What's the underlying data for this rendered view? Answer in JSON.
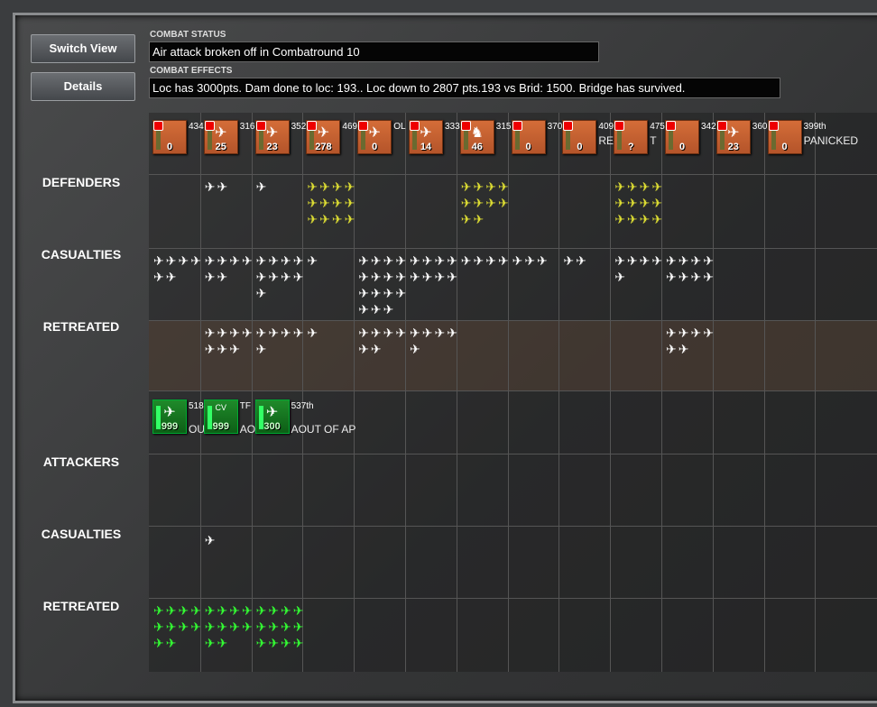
{
  "buttons": {
    "switch_view": "Switch View",
    "details": "Details"
  },
  "combat_status": {
    "label": "COMBAT STATUS",
    "text": "Air attack broken off in Combatround  10"
  },
  "combat_effects": {
    "label": "COMBAT EFFECTS",
    "text": "Loc has  3000pts. Dam done to loc: 193.. Loc down to 2807 pts.193 vs Brid: 1500. Bridge has survived."
  },
  "rows": {
    "defenders": "DEFENDERS",
    "def_casualties": "CASUALTIES",
    "def_retreated": "RETREATED",
    "attackers": "ATTACKERS",
    "att_casualties": "CASUALTIES",
    "att_retreated": "RETREATED"
  },
  "defender_units": [
    {
      "id": "434",
      "value": "0",
      "icon": ""
    },
    {
      "id": "316",
      "value": "25",
      "icon": "plane"
    },
    {
      "id": "352",
      "value": "23",
      "icon": "plane"
    },
    {
      "id": "469",
      "value": "278",
      "icon": "plane"
    },
    {
      "id": "OL",
      "value": "0",
      "icon": "plane"
    },
    {
      "id": "333",
      "value": "14",
      "icon": "plane"
    },
    {
      "id": "315",
      "value": "46",
      "icon": "infantry"
    },
    {
      "id": "370",
      "value": "0",
      "icon": ""
    },
    {
      "id": "409",
      "value": "0",
      "icon": "",
      "status": "RE"
    },
    {
      "id": "475",
      "value": "?",
      "icon": "",
      "status": "T"
    },
    {
      "id": "342",
      "value": "0",
      "icon": ""
    },
    {
      "id": "360",
      "value": "23",
      "icon": "plane"
    },
    {
      "id": "399th",
      "value": "0",
      "icon": "",
      "status": "PANICKED"
    }
  ],
  "attacker_units": [
    {
      "id": "518",
      "value": "999",
      "badge": "",
      "status": "OU"
    },
    {
      "id": "TF",
      "value": "999",
      "badge": "CV",
      "status": "AOU"
    },
    {
      "id": "537th",
      "value": "300",
      "badge": "",
      "status": "AOUT OF AP"
    }
  ],
  "icon_counts": {
    "defenders": [
      0,
      2,
      1,
      12,
      0,
      0,
      10,
      0,
      0,
      12,
      0,
      0,
      0
    ],
    "def_casualties": [
      6,
      6,
      9,
      1,
      15,
      8,
      4,
      3,
      2,
      5,
      8,
      0,
      0
    ],
    "def_retreated": [
      0,
      7,
      5,
      1,
      6,
      5,
      0,
      0,
      0,
      0,
      6,
      0,
      0
    ],
    "att_casualties": [
      0,
      1,
      0,
      0,
      0,
      0,
      0,
      0,
      0,
      0,
      0,
      0,
      0
    ],
    "att_retreated": [
      10,
      10,
      12,
      0,
      0,
      0,
      0,
      0,
      0,
      0,
      0,
      0,
      0
    ]
  },
  "icons": {
    "plane": "✈",
    "infantry": "♞"
  }
}
